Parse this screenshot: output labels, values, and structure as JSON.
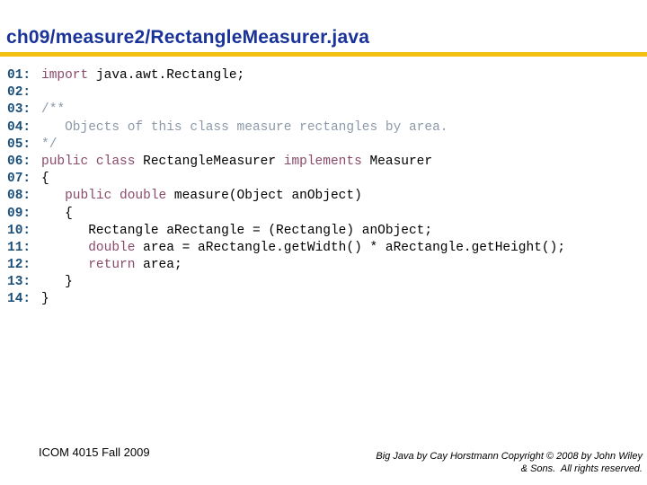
{
  "slide": {
    "title": "ch09/measure2/RectangleMeasurer.java",
    "colors": {
      "title": "#1a3399",
      "rule": "#f2c010",
      "line_number": "#1a4f7a",
      "keyword": "#8a4a6a",
      "comment": "#8c9aaa",
      "plain": "#000000"
    }
  },
  "code": {
    "lines": [
      {
        "num": "01:",
        "tokens": [
          {
            "t": "kw",
            "v": "import"
          },
          {
            "t": "pl",
            "v": " java.awt.Rectangle;"
          }
        ]
      },
      {
        "num": "02:",
        "tokens": []
      },
      {
        "num": "03:",
        "tokens": [
          {
            "t": "cm",
            "v": "/**"
          }
        ]
      },
      {
        "num": "04:",
        "tokens": [
          {
            "t": "cm",
            "v": "   Objects of this class measure rectangles by area."
          }
        ]
      },
      {
        "num": "05:",
        "tokens": [
          {
            "t": "cm",
            "v": "*/"
          }
        ]
      },
      {
        "num": "06:",
        "tokens": [
          {
            "t": "kw",
            "v": "public class"
          },
          {
            "t": "pl",
            "v": " RectangleMeasurer "
          },
          {
            "t": "kw",
            "v": "implements"
          },
          {
            "t": "pl",
            "v": " Measurer"
          }
        ]
      },
      {
        "num": "07:",
        "tokens": [
          {
            "t": "pl",
            "v": "{"
          }
        ]
      },
      {
        "num": "08:",
        "tokens": [
          {
            "t": "pl",
            "v": "   "
          },
          {
            "t": "kw",
            "v": "public double"
          },
          {
            "t": "pl",
            "v": " measure(Object anObject)"
          }
        ]
      },
      {
        "num": "09:",
        "tokens": [
          {
            "t": "pl",
            "v": "   {"
          }
        ]
      },
      {
        "num": "10:",
        "tokens": [
          {
            "t": "pl",
            "v": "      Rectangle aRectangle = (Rectangle) anObject;"
          }
        ]
      },
      {
        "num": "11:",
        "tokens": [
          {
            "t": "pl",
            "v": "      "
          },
          {
            "t": "kw",
            "v": "double"
          },
          {
            "t": "pl",
            "v": " area = aRectangle.getWidth() * aRectangle.getHeight();"
          }
        ]
      },
      {
        "num": "12:",
        "tokens": [
          {
            "t": "pl",
            "v": "      "
          },
          {
            "t": "kw",
            "v": "return"
          },
          {
            "t": "pl",
            "v": " area;"
          }
        ]
      },
      {
        "num": "13:",
        "tokens": [
          {
            "t": "pl",
            "v": "   }"
          }
        ]
      },
      {
        "num": "14:",
        "tokens": [
          {
            "t": "pl",
            "v": "}"
          }
        ]
      }
    ]
  },
  "footer": {
    "left": "ICOM 4015 Fall 2009",
    "right_line1": "Big Java by Cay Horstmann Copyright © 2008 by John Wiley",
    "right_line2": "& Sons.  All rights reserved."
  }
}
